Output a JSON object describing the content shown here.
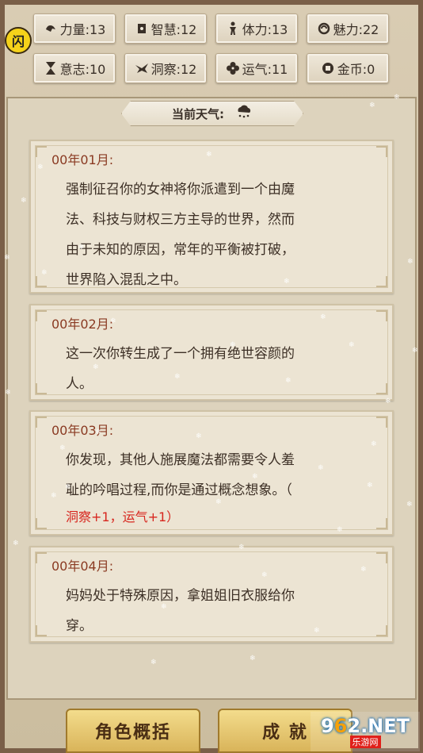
{
  "side_badge": "闪",
  "stats": [
    {
      "label": "力量:13",
      "icon": "muscle-icon"
    },
    {
      "label": "智慧:12",
      "icon": "book-icon"
    },
    {
      "label": "体力:13",
      "icon": "person-icon"
    },
    {
      "label": "魅力:22",
      "icon": "charm-icon"
    },
    {
      "label": "意志:10",
      "icon": "hourglass-icon"
    },
    {
      "label": "洞察:12",
      "icon": "eagle-icon"
    },
    {
      "label": "运气:11",
      "icon": "clover-icon"
    },
    {
      "label": "金币:0",
      "icon": "coin-icon"
    }
  ],
  "weather": {
    "label": "当前天气:",
    "icon": "snow-cloud-icon"
  },
  "events": [
    {
      "date": "00年01月:",
      "lines": [
        "强制征召你的女神将你派遣到一个由魔",
        "法、科技与财权三方主导的世界，然而",
        "由于未知的原因，常年的平衡被打破，",
        "世界陷入混乱之中。"
      ]
    },
    {
      "date": "00年02月:",
      "lines": [
        "这一次你转生成了一个拥有绝世容颜的",
        "人。"
      ]
    },
    {
      "date": "00年03月:",
      "lines": [
        "你发现，其他人施展魔法都需要令人羞",
        "耻的吟唱过程,而你是通过概念想象。（"
      ],
      "bonus": "洞察+1，运气+1）"
    },
    {
      "date": "00年04月:",
      "lines": [
        "妈妈处于特殊原因，拿姐姐旧衣服给你",
        "穿。"
      ]
    }
  ],
  "bottom": {
    "left_label": "角色概括",
    "right_label": "成 就"
  },
  "watermark": {
    "brand_a": "9",
    "brand_b": "6",
    "brand_c": "2",
    "brand_d": ".NET",
    "sub": "乐游网"
  },
  "colors": {
    "date": "#8a3a22",
    "bonus": "#d7261e",
    "accent": "#d9b45a"
  }
}
